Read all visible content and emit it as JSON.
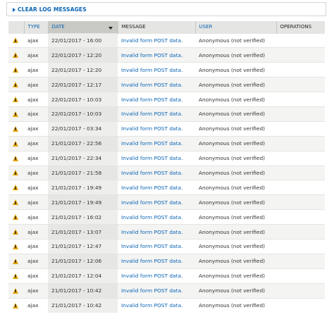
{
  "filter_panel": {
    "label": "CLEAR LOG MESSAGES"
  },
  "columns": {
    "type": "TYPE",
    "date": "DATE",
    "message": "MESSAGE",
    "user": "USER",
    "operations": "OPERATIONS"
  },
  "colors": {
    "link": "#0a65b4",
    "warning": "#e3a400",
    "header_bg": "#e5e5e3"
  },
  "rows": [
    {
      "severity_icon": "warning-icon",
      "type": "ajax",
      "date": "22/01/2017 - 16:00",
      "message": "Invalid form POST data.",
      "user": "Anonymous (not verified)",
      "operations": ""
    },
    {
      "severity_icon": "warning-icon",
      "type": "ajax",
      "date": "22/01/2017 - 12:20",
      "message": "Invalid form POST data.",
      "user": "Anonymous (not verified)",
      "operations": ""
    },
    {
      "severity_icon": "warning-icon",
      "type": "ajax",
      "date": "22/01/2017 - 12:20",
      "message": "Invalid form POST data.",
      "user": "Anonymous (not verified)",
      "operations": ""
    },
    {
      "severity_icon": "warning-icon",
      "type": "ajax",
      "date": "22/01/2017 - 12:17",
      "message": "Invalid form POST data.",
      "user": "Anonymous (not verified)",
      "operations": ""
    },
    {
      "severity_icon": "warning-icon",
      "type": "ajax",
      "date": "22/01/2017 - 10:03",
      "message": "Invalid form POST data.",
      "user": "Anonymous (not verified)",
      "operations": ""
    },
    {
      "severity_icon": "warning-icon",
      "type": "ajax",
      "date": "22/01/2017 - 10:03",
      "message": "Invalid form POST data.",
      "user": "Anonymous (not verified)",
      "operations": ""
    },
    {
      "severity_icon": "warning-icon",
      "type": "ajax",
      "date": "22/01/2017 - 03:34",
      "message": "Invalid form POST data.",
      "user": "Anonymous (not verified)",
      "operations": ""
    },
    {
      "severity_icon": "warning-icon",
      "type": "ajax",
      "date": "21/01/2017 - 22:56",
      "message": "Invalid form POST data.",
      "user": "Anonymous (not verified)",
      "operations": ""
    },
    {
      "severity_icon": "warning-icon",
      "type": "ajax",
      "date": "21/01/2017 - 22:34",
      "message": "Invalid form POST data.",
      "user": "Anonymous (not verified)",
      "operations": ""
    },
    {
      "severity_icon": "warning-icon",
      "type": "ajax",
      "date": "21/01/2017 - 21:58",
      "message": "Invalid form POST data.",
      "user": "Anonymous (not verified)",
      "operations": ""
    },
    {
      "severity_icon": "warning-icon",
      "type": "ajax",
      "date": "21/01/2017 - 19:49",
      "message": "Invalid form POST data.",
      "user": "Anonymous (not verified)",
      "operations": ""
    },
    {
      "severity_icon": "warning-icon",
      "type": "ajax",
      "date": "21/01/2017 - 19:49",
      "message": "Invalid form POST data.",
      "user": "Anonymous (not verified)",
      "operations": ""
    },
    {
      "severity_icon": "warning-icon",
      "type": "ajax",
      "date": "21/01/2017 - 16:02",
      "message": "Invalid form POST data.",
      "user": "Anonymous (not verified)",
      "operations": ""
    },
    {
      "severity_icon": "warning-icon",
      "type": "ajax",
      "date": "21/01/2017 - 13:07",
      "message": "Invalid form POST data.",
      "user": "Anonymous (not verified)",
      "operations": ""
    },
    {
      "severity_icon": "warning-icon",
      "type": "ajax",
      "date": "21/01/2017 - 12:47",
      "message": "Invalid form POST data.",
      "user": "Anonymous (not verified)",
      "operations": ""
    },
    {
      "severity_icon": "warning-icon",
      "type": "ajax",
      "date": "21/01/2017 - 12:06",
      "message": "Invalid form POST data.",
      "user": "Anonymous (not verified)",
      "operations": ""
    },
    {
      "severity_icon": "warning-icon",
      "type": "ajax",
      "date": "21/01/2017 - 12:04",
      "message": "Invalid form POST data.",
      "user": "Anonymous (not verified)",
      "operations": ""
    },
    {
      "severity_icon": "warning-icon",
      "type": "ajax",
      "date": "21/01/2017 - 10:42",
      "message": "Invalid form POST data.",
      "user": "Anonymous (not verified)",
      "operations": ""
    },
    {
      "severity_icon": "warning-icon",
      "type": "ajax",
      "date": "21/01/2017 - 10:42",
      "message": "Invalid form POST data.",
      "user": "Anonymous (not verified)",
      "operations": ""
    }
  ]
}
